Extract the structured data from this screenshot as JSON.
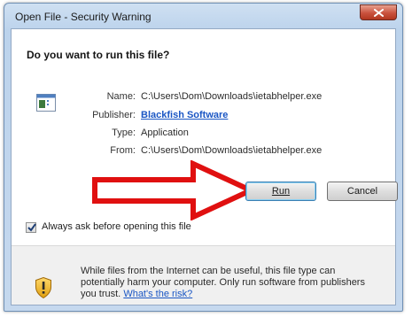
{
  "window": {
    "title": "Open File - Security Warning"
  },
  "dialog": {
    "question": "Do you want to run this file?",
    "fields": [
      {
        "label": "Name:",
        "value": "C:\\Users\\Dom\\Downloads\\ietabhelper.exe"
      },
      {
        "label": "Publisher:",
        "value": "Blackfish Software"
      },
      {
        "label": "Type:",
        "value": "Application"
      },
      {
        "label": "From:",
        "value": "C:\\Users\\Dom\\Downloads\\ietabhelper.exe"
      }
    ],
    "run_label": "Run",
    "cancel_label": "Cancel",
    "checkbox_label": "Always ask before opening this file",
    "checkbox_checked": true,
    "warning_text": "While files from the Internet can be useful, this file type can potentially harm your computer. Only run software from publishers you trust.",
    "warning_link": "What's the risk?"
  },
  "colors": {
    "link": "#1a56c4",
    "arrow_red": "#e01010",
    "close_red": "#c9523e"
  },
  "icons": [
    "close-icon",
    "application-icon",
    "red-arrow-icon",
    "checkmark-icon",
    "shield-warning-icon"
  ]
}
